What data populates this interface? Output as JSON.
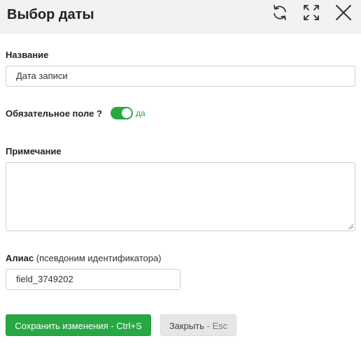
{
  "dialog": {
    "title": "Выбор даты",
    "icons": [
      "refresh-icon",
      "expand-icon",
      "close-icon"
    ]
  },
  "form": {
    "name_label": "Название",
    "name_value": "Дата записи",
    "required_label": "Обязательное поле ?",
    "required_on": true,
    "required_state_text": "да",
    "note_label": "Примечание",
    "note_value": "",
    "alias_label": "Алиас",
    "alias_sublabel": "(псевдоним идентификатора)",
    "alias_value": "field_3749202"
  },
  "buttons": {
    "save_label": "Сохранить изменения",
    "save_hint": "- Ctrl+S",
    "close_label": "Закрыть",
    "close_hint": "- Esc"
  },
  "colors": {
    "accent": "#27a844",
    "header_bg": "#f2f2f2",
    "secondary_button_bg": "#e6e6e6"
  }
}
